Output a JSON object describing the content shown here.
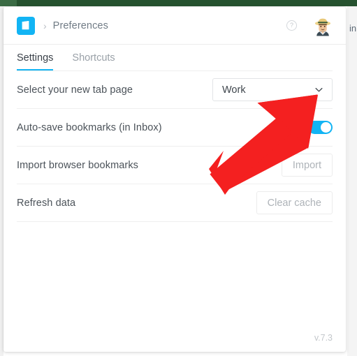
{
  "window": {
    "background_strip_color": "#26522f",
    "panel_background": "#ffffff",
    "bleed_text": "in"
  },
  "header": {
    "logo_icon": "app-logo-icon",
    "logo_color": "#12b4f4",
    "breadcrumb_separator": "›",
    "title": "Preferences",
    "help_icon": "help-circle-icon",
    "help_glyph": "?",
    "avatar_icon": "user-avatar-icon"
  },
  "tabs": [
    {
      "label": "Settings",
      "active": true
    },
    {
      "label": "Shortcuts",
      "active": false
    }
  ],
  "accent_color": "#12b4f4",
  "settings_rows": [
    {
      "label": "Select your new tab page",
      "control": "select",
      "value": "Work",
      "chevron_icon": "chevron-down-icon"
    },
    {
      "label": "Auto-save bookmarks (in Inbox)",
      "control": "toggle",
      "value": "on"
    },
    {
      "label": "Import browser bookmarks",
      "control": "button",
      "value": "Import"
    },
    {
      "label": "Refresh data",
      "control": "button",
      "value": "Clear cache"
    }
  ],
  "footer": {
    "version": "v.7.3"
  },
  "annotation": {
    "shape": "arrow",
    "color": "#f42020",
    "points_to": "new-tab-page-select-chevron"
  }
}
